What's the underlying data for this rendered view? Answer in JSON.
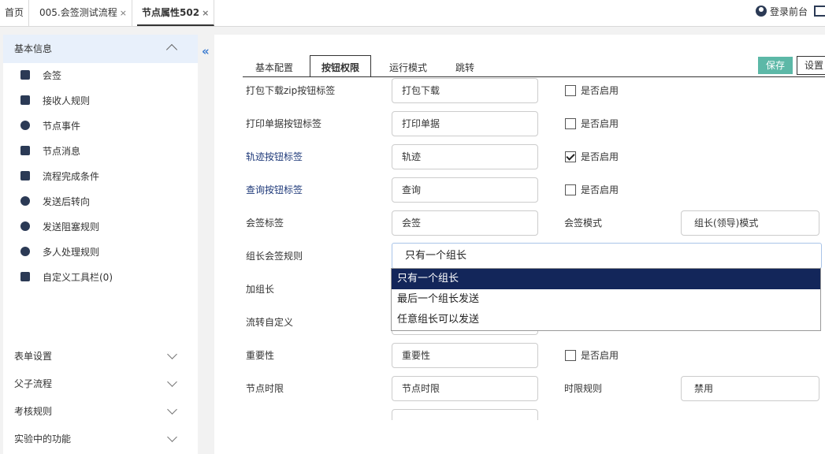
{
  "top_tabs": [
    {
      "label": "首页",
      "closable": false
    },
    {
      "label": "005.会签测试流程",
      "closable": true
    },
    {
      "label": "节点属性502",
      "closable": true,
      "active": true
    }
  ],
  "close_glyph": "×",
  "top_right": {
    "login_label": "登录前台",
    "login_icon": "user-circle-icon",
    "exit_icon": "exit-icon"
  },
  "sidebar": {
    "section_title": "基本信息",
    "collapse_glyph": "«",
    "items": [
      {
        "label": "会签",
        "icon": "doc-icon"
      },
      {
        "label": "接收人规则",
        "icon": "save-icon"
      },
      {
        "label": "节点事件",
        "icon": "event-icon"
      },
      {
        "label": "节点消息",
        "icon": "message-icon"
      },
      {
        "label": "流程完成条件",
        "icon": "list-icon"
      },
      {
        "label": "发送后转向",
        "icon": "redirect-icon"
      },
      {
        "label": "发送阻塞规则",
        "icon": "block-icon"
      },
      {
        "label": "多人处理规则",
        "icon": "users-icon"
      },
      {
        "label": "自定义工具栏(0)",
        "icon": "edit-icon"
      }
    ],
    "groups": [
      {
        "label": "表单设置"
      },
      {
        "label": "父子流程"
      },
      {
        "label": "考核规则"
      },
      {
        "label": "实验中的功能"
      }
    ]
  },
  "main": {
    "tabs": [
      {
        "label": "基本配置"
      },
      {
        "label": "按钮权限",
        "active": true
      },
      {
        "label": "运行模式"
      },
      {
        "label": "跳转"
      }
    ],
    "save_label": "保存",
    "settings_label": "设置",
    "enable_label": "是否启用",
    "rows": [
      {
        "label": "打包下载zip按钮标签",
        "value": "打包下载",
        "checked": false
      },
      {
        "label": "打印单据按钮标签",
        "value": "打印单据",
        "checked": false
      },
      {
        "label": "轨迹按钮标签",
        "value": "轨迹",
        "checked": true
      },
      {
        "label": "查询按钮标签",
        "value": "查询",
        "checked": false
      },
      {
        "label": "会签标签",
        "value": "会签",
        "label2": "会签模式",
        "value2": "组长(领导)模式"
      },
      {
        "label": "组长会签规则"
      },
      {
        "label": "加组长"
      },
      {
        "label": "流转自定义"
      },
      {
        "label": "重要性",
        "value": "重要性",
        "checked": false
      },
      {
        "label": "节点时限",
        "value": "节点时限",
        "label2": "时限规则",
        "value2": "禁用"
      }
    ],
    "leader_rule": {
      "selected": "只有一个组长",
      "options": [
        "只有一个组长",
        "最后一个组长发送",
        "任意组长可以发送"
      ]
    }
  },
  "colors": {
    "accent": "#5cb8a7",
    "selected_option": "#13265a",
    "sidebar_head": "#e8f0fb",
    "icon": "#2b3a55"
  }
}
